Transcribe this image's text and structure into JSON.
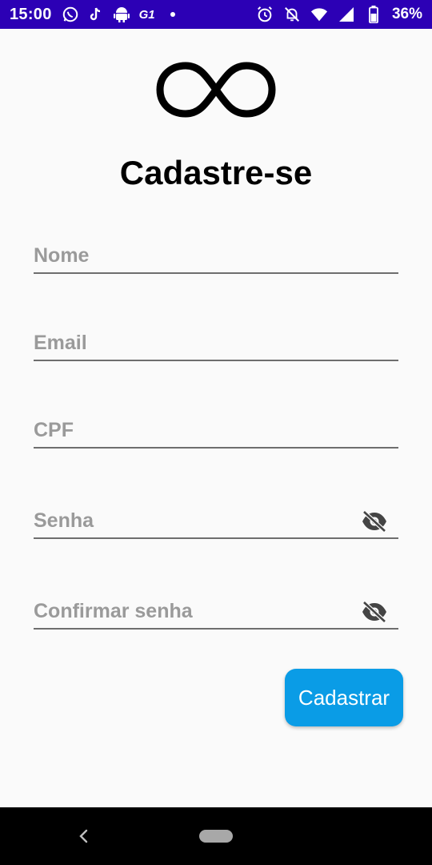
{
  "status_bar": {
    "time": "15:00",
    "left_icons": [
      "whatsapp-icon",
      "tiktok-icon",
      "android-icon",
      "g1-icon",
      "dot-icon"
    ],
    "g1_text": "G1",
    "right_icons": [
      "alarm-icon",
      "notifications-off-icon",
      "wifi-icon",
      "signal-icon",
      "battery-icon"
    ],
    "battery": "36%",
    "background_color": "#2c00b5"
  },
  "logo": {
    "icon": "infinity-logo-icon"
  },
  "page": {
    "title": "Cadastre-se"
  },
  "form": {
    "fields": [
      {
        "placeholder": "Nome",
        "value": ""
      },
      {
        "placeholder": "Email",
        "value": ""
      },
      {
        "placeholder": "CPF",
        "value": ""
      },
      {
        "placeholder": "Senha",
        "value": "",
        "toggle_icon": "eye-off-icon"
      },
      {
        "placeholder": "Confirmar senha",
        "value": "",
        "toggle_icon": "eye-off-icon"
      }
    ],
    "submit_label": "Cadastrar",
    "accent_color": "#0a9ce6"
  },
  "nav_bar": {
    "icons": [
      "back-icon",
      "home-pill-icon"
    ]
  }
}
